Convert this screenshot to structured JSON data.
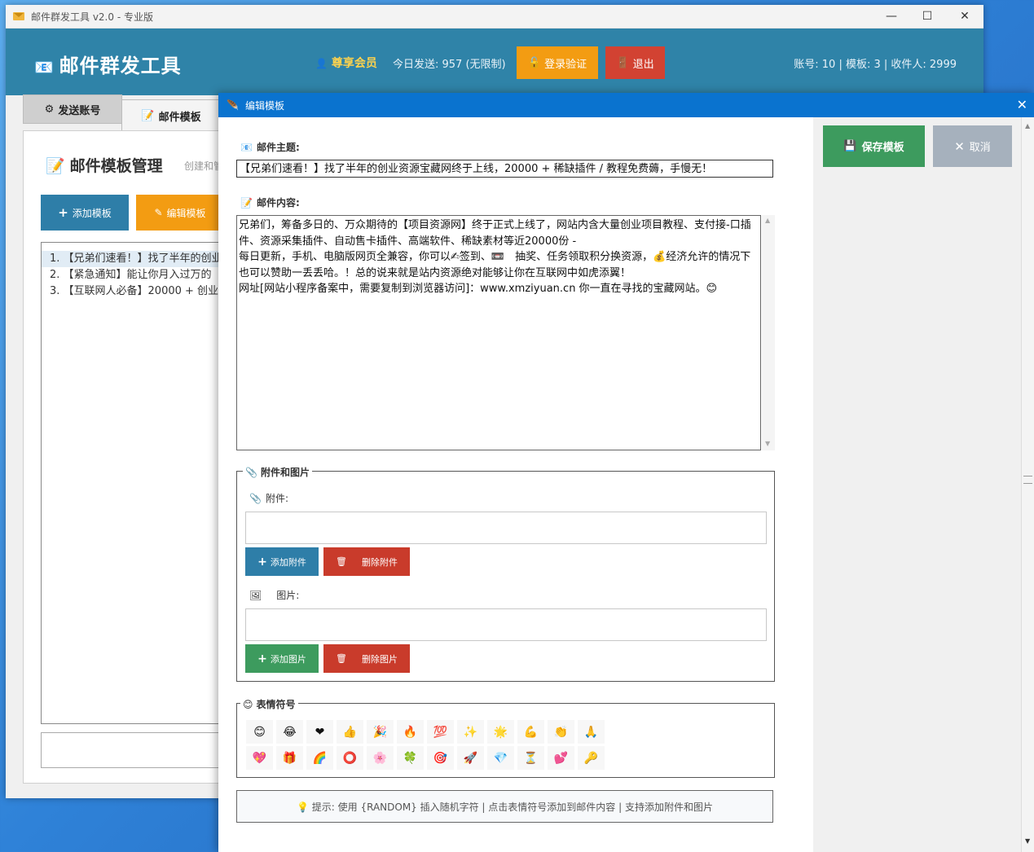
{
  "window": {
    "title": "邮件群发工具 v2.0 - 专业版",
    "controls": {
      "minimize": "—",
      "maximize": "☐",
      "close": "✕"
    }
  },
  "header": {
    "app_name": "邮件群发工具",
    "vip_label": "尊享会员",
    "today_sent": "今日发送: 957 (无限制)",
    "login_label": "登录验证",
    "logout_label": "退出",
    "stats": "账号: 10 | 模板: 3 | 收件人: 2999"
  },
  "tabs": [
    {
      "label": "发送账号"
    },
    {
      "label": "邮件模板"
    }
  ],
  "template_page": {
    "title": "邮件模板管理",
    "subtitle": "创建和管",
    "add_label": "添加模板",
    "edit_label": "编辑模板",
    "templates": [
      "1. 【兄弟们速看！】找了半年的创业",
      "2. 【紧急通知】能让你月入过万的【",
      "3. 【互联网人必备】20000 + 创业补"
    ]
  },
  "dialog": {
    "title": "编辑模板",
    "close": "✕",
    "save_label": "保存模板",
    "cancel_label": "取消",
    "subject_label": "邮件主题:",
    "subject_value": "【兄弟们速看！】找了半年的创业资源宝藏网终于上线，20000 + 稀缺插件 / 教程免费薅，手慢无！",
    "body_label": "邮件内容:",
    "body_lines": [
      "兄弟们，筹备多日的、万众期待的【项目资源网】终于正式上线了，网站内含大量创业项目教程、支付接-口插件、资源采集插件、自动售卡插件、高端软件、稀缺素材等近20000份 -",
      "每日更新，手机、电脑版网页全兼容，你可以✍签到、📼　抽奖、任务领取积分换资源，💰经济允许的情况下也可以赞助一丢丢哈。！总的说来就是站内资源绝对能够让你在互联网中如虎添翼！",
      "网址[网站小程序备案中，需要复制到浏览器访问]：www.xmziyuan.cn 你一直在寻找的宝藏网站。😊"
    ],
    "attach_group_label": "附件和图片",
    "attach_label": "附件:",
    "add_attach_label": "添加附件",
    "del_attach_label": "删除附件",
    "image_label": "图片:",
    "add_image_label": "添加图片",
    "del_image_label": "删除图片",
    "emoji_group_label": "表情符号",
    "emoji_row1": [
      "😊",
      "😂",
      "❤",
      "👍",
      "🎉",
      "🔥",
      "💯",
      "✨",
      "🌟",
      "💪",
      "👏",
      "🙏"
    ],
    "emoji_row2": [
      "💖",
      "🎁",
      "🌈",
      "⭕",
      "🌸",
      "🍀",
      "🎯",
      "🚀",
      "💎",
      "⏳",
      "💕",
      "🔑"
    ],
    "hint": "💡 提示: 使用 {RANDOM} 插入随机字符 | 点击表情符号添加到邮件内容 | 支持添加附件和图片"
  }
}
